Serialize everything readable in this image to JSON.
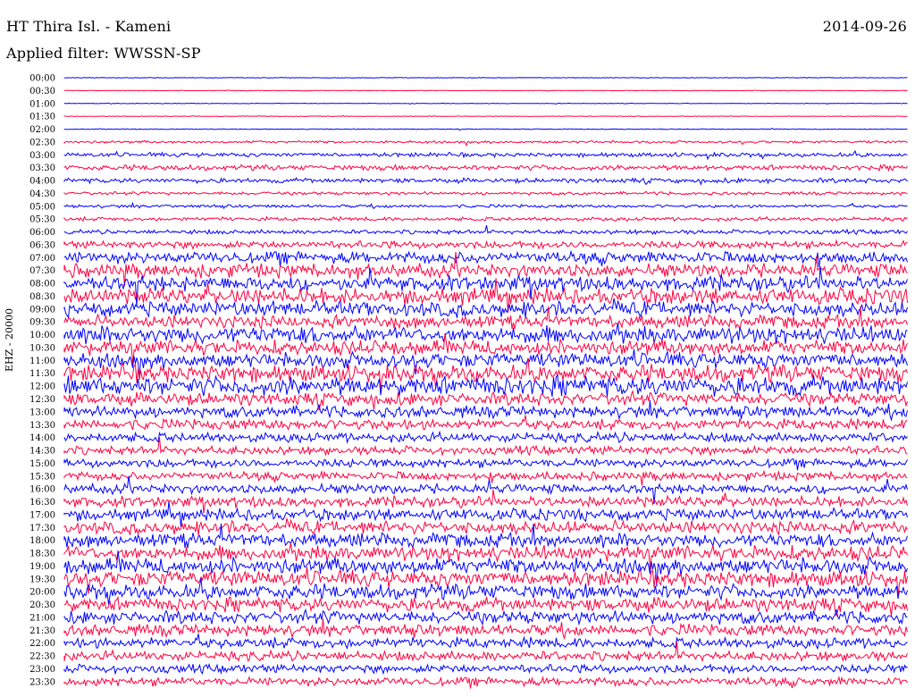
{
  "header": {
    "station": "HT Thira Isl. - Kameni",
    "date": "2014-09-26",
    "filter": "Applied filter: WWSSN-SP"
  },
  "channel_label": "EHZ - 20000",
  "colors": {
    "odd": "#0000ff",
    "even": "#ff0040"
  },
  "chart_data": {
    "type": "line",
    "title": "HT Thira Isl. - Kameni",
    "subtitle": "Applied filter: WWSSN-SP",
    "ylabel": "EHZ - 20000",
    "tick_labels": [
      "00:00",
      "00:30",
      "01:00",
      "01:30",
      "02:00",
      "02:30",
      "03:00",
      "03:30",
      "04:00",
      "04:30",
      "05:00",
      "05:30",
      "06:00",
      "06:30",
      "07:00",
      "07:30",
      "08:00",
      "08:30",
      "09:00",
      "09:30",
      "10:00",
      "10:30",
      "11:00",
      "11:30",
      "12:00",
      "12:30",
      "13:00",
      "13:30",
      "14:00",
      "14:30",
      "15:00",
      "15:30",
      "16:00",
      "16:30",
      "17:00",
      "17:30",
      "18:00",
      "18:30",
      "19:00",
      "19:30",
      "20:00",
      "20:30",
      "21:00",
      "21:30",
      "22:00",
      "22:30",
      "23:00",
      "23:30"
    ],
    "trace_noise_level": [
      0.3,
      0.3,
      0.3,
      0.3,
      0.4,
      1.2,
      2.0,
      2.5,
      2.2,
      1.5,
      1.5,
      1.8,
      2.0,
      3.5,
      5.5,
      6.5,
      7.0,
      7.5,
      7.0,
      6.0,
      8.0,
      7.0,
      7.0,
      8.0,
      9.0,
      6.0,
      5.5,
      5.0,
      4.5,
      4.0,
      4.0,
      4.0,
      4.5,
      5.0,
      5.5,
      6.0,
      6.5,
      7.0,
      7.5,
      7.5,
      7.0,
      6.5,
      6.0,
      5.5,
      5.0,
      4.5,
      4.0,
      4.0
    ],
    "grid": false
  }
}
